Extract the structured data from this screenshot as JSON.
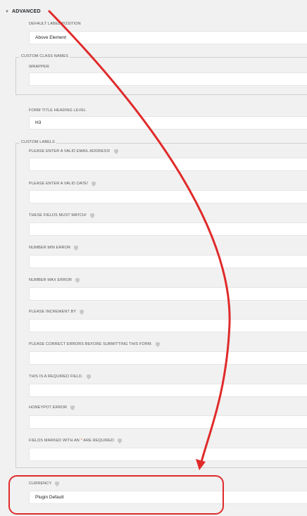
{
  "advanced": {
    "header": "ADVANCED",
    "default_label_position": {
      "label": "DEFAULT LABEL POSITION",
      "value": "Above Element"
    }
  },
  "custom_class_names": {
    "legend": "CUSTOM CLASS NAMES",
    "wrapper_label": "WRAPPER",
    "wrapper_value": ""
  },
  "form_title_heading": {
    "label": "FORM TITLE HEADING LEVEL",
    "value": "H3"
  },
  "custom_labels": {
    "legend": "CUSTOM LABELS",
    "items": [
      {
        "label": "PLEASE ENTER A VALID EMAIL ADDRESS!",
        "value": ""
      },
      {
        "label": "PLEASE ENTER A VALID DATE!",
        "value": ""
      },
      {
        "label": "THESE FIELDS MUST MATCH!",
        "value": ""
      },
      {
        "label": "NUMBER MIN ERROR",
        "value": ""
      },
      {
        "label": "NUMBER MAX ERROR",
        "value": ""
      },
      {
        "label": "PLEASE INCREMENT BY",
        "value": ""
      },
      {
        "label": "PLEASE CORRECT ERRORS BEFORE SUBMITTING THIS FORM.",
        "value": ""
      },
      {
        "label": "THIS IS A REQUIRED FIELD.",
        "value": ""
      },
      {
        "label": "HONEYPOT ERROR",
        "value": ""
      },
      {
        "label_before": "FIELDS MARKED WITH AN",
        "required_mark": "*",
        "label_after": "ARE REQUIRED",
        "value": ""
      }
    ]
  },
  "currency": {
    "label": "CURRENCY",
    "value": "Plugin Default"
  },
  "colors": {
    "highlight": "#e02a2a",
    "required": "#d54e21"
  }
}
